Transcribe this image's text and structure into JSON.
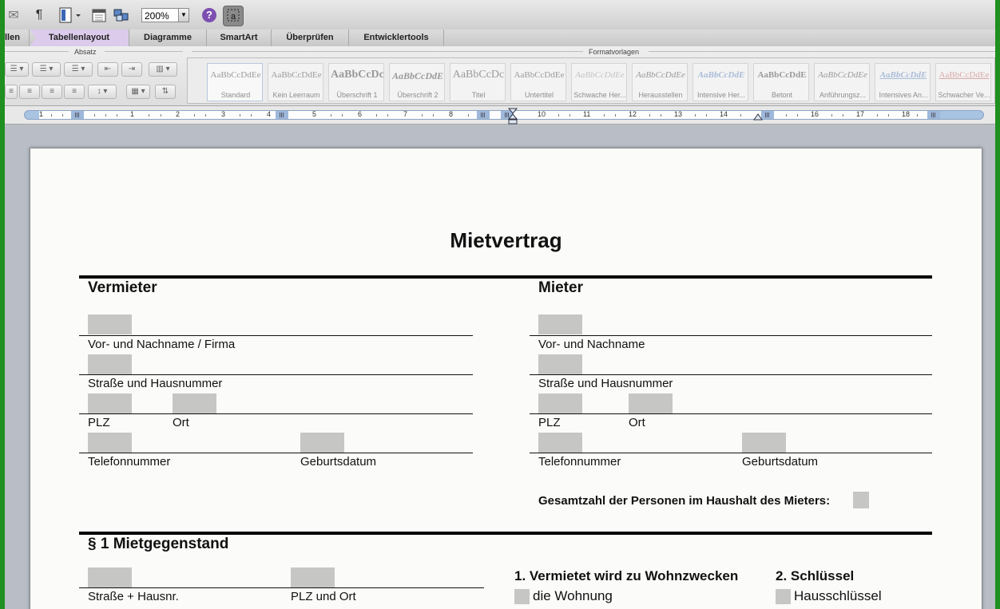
{
  "toolbar": {
    "paragraph_icon": "¶",
    "zoom_value": "200%",
    "help_icon": "?"
  },
  "ribbon_tabs": {
    "partial": "llen",
    "tabellenlayout": "Tabellenlayout",
    "diagramme": "Diagramme",
    "smartart": "SmartArt",
    "ueberpruefen": "Überprüfen",
    "entwicklertools": "Entwicklertools"
  },
  "ribbon_groups": {
    "absatz": "Absatz",
    "formatvorlagen": "Formatvorlagen"
  },
  "styles": [
    {
      "sample": "AaBbCcDdEe",
      "label": "Standard"
    },
    {
      "sample": "AaBbCcDdEe",
      "label": "Kein Leerraum"
    },
    {
      "sample": "AaBbCcDc",
      "label": "Überschrift 1"
    },
    {
      "sample": "AaBbCcDdE",
      "label": "Überschrift 2"
    },
    {
      "sample": "AaBbCcDc",
      "label": "Titel"
    },
    {
      "sample": "AaBbCcDdEe",
      "label": "Untertitel"
    },
    {
      "sample": "AaBbCcDdEe",
      "label": "Schwache Her..."
    },
    {
      "sample": "AaBbCcDdEe",
      "label": "Herausstellen"
    },
    {
      "sample": "AaBbCcDdE",
      "label": "Intensive Her..."
    },
    {
      "sample": "AaBbCcDdE",
      "label": "Betont"
    },
    {
      "sample": "AaBbCcDdEe",
      "label": "Anführungsz..."
    },
    {
      "sample": "AaBbCcDdE",
      "label": "Intensives An..."
    },
    {
      "sample": "AaBbCcDdEe",
      "label": "Schwacher Ve..."
    }
  ],
  "ruler": {
    "numbers": [
      "1",
      "1",
      "2",
      "3",
      "4",
      "5",
      "6",
      "7",
      "8",
      "10",
      "11",
      "12",
      "13",
      "14",
      "16",
      "17",
      "18"
    ]
  },
  "document": {
    "title": "Mietvertrag",
    "vermieter": {
      "heading": "Vermieter",
      "name_label": "Vor- und Nachname / Firma",
      "street_label": "Straße und Hausnummer",
      "plz_label": "PLZ",
      "ort_label": "Ort",
      "phone_label": "Telefonnummer",
      "birth_label": "Geburtsdatum"
    },
    "mieter": {
      "heading": "Mieter",
      "name_label": "Vor- und Nachname",
      "street_label": "Straße und Hausnummer",
      "plz_label": "PLZ",
      "ort_label": "Ort",
      "phone_label": "Telefonnummer",
      "birth_label": "Geburtsdatum",
      "persons_label": "Gesamtzahl der Personen im Haushalt des Mieters:"
    },
    "section1": {
      "heading": "§ 1 Mietgegenstand",
      "street_label": "Straße + Hausnr.",
      "plz_ort_label": "PLZ und Ort",
      "purpose_heading": "1. Vermietet wird zu Wohnzwecken",
      "purpose_option": "die Wohnung",
      "keys_heading": "2. Schlüssel",
      "keys_option": "Hausschlüssel"
    }
  }
}
